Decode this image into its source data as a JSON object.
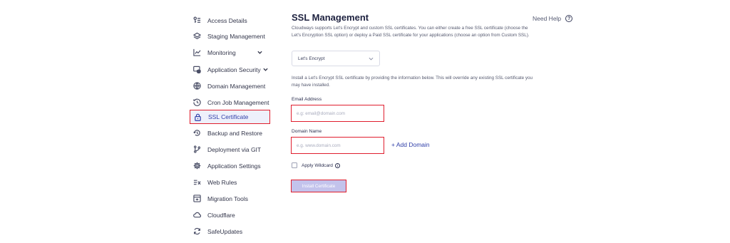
{
  "sidebar": {
    "items": [
      {
        "label": "Access Details",
        "icon": "key-list-icon"
      },
      {
        "label": "Staging Management",
        "icon": "layers-icon"
      },
      {
        "label": "Monitoring",
        "icon": "chart-line-icon",
        "has_chevron": true
      },
      {
        "label": "Application Security",
        "icon": "shield-screen-icon",
        "has_chevron": true
      },
      {
        "label": "Domain Management",
        "icon": "globe-icon"
      },
      {
        "label": "Cron Job Management",
        "icon": "clock-icon"
      },
      {
        "label": "SSL Certificate",
        "icon": "lock-icon",
        "active": true
      },
      {
        "label": "Backup and Restore",
        "icon": "restore-icon"
      },
      {
        "label": "Deployment via GIT",
        "icon": "git-icon"
      },
      {
        "label": "Application Settings",
        "icon": "gear-icon"
      },
      {
        "label": "Web Rules",
        "icon": "rules-icon"
      },
      {
        "label": "Migration Tools",
        "icon": "migration-icon"
      },
      {
        "label": "Cloudflare",
        "icon": "cloud-icon"
      },
      {
        "label": "SafeUpdates",
        "icon": "refresh-icon"
      }
    ]
  },
  "main": {
    "title": "SSL Management",
    "help_label": "Need Help",
    "description": "Cloudways supports Let's Encrypt and custom SSL certificates. You can either create a free SSL certificate (choose the Let's Encryption SSL option) or deploy a Paid SSL certificate for your applications (choose an option from Custom SSL).",
    "ssl_type_selected": "Let's Encrypt",
    "install_description": "Install a Let's Encrypt SSL certificate by providing the information below. This will override any existing SSL certificate you may have installed.",
    "email_label": "Email Address",
    "email_placeholder": "e.g: email@domain.com",
    "domain_label": "Domain Name",
    "domain_placeholder": "e.g. www.domain.com",
    "add_domain_label": "+ Add Domain",
    "wildcard_label": "Apply Wildcard",
    "install_button_label": "Install Certificate"
  },
  "colors": {
    "accent": "#2f3ea8",
    "highlight_border": "#e01e2e",
    "button_bg": "#c3c3ec"
  }
}
